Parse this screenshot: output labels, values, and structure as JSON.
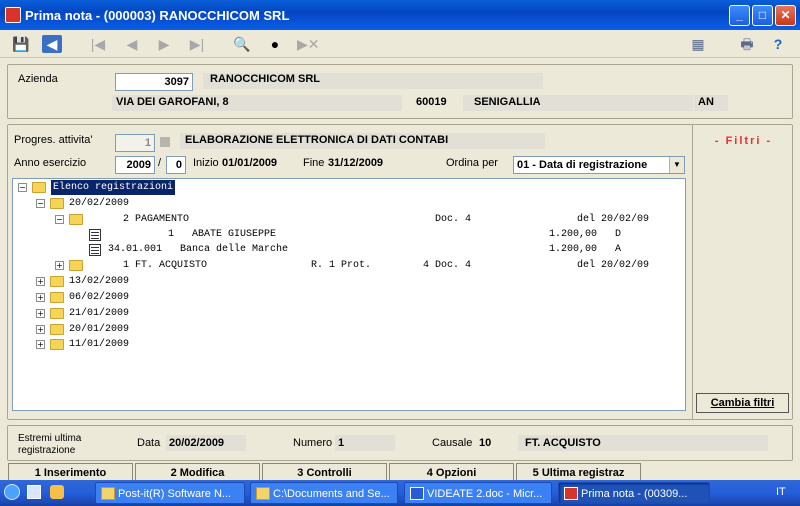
{
  "window": {
    "title": "Prima nota  -  (000003) RANOCCHICOM SRL"
  },
  "azienda": {
    "label": "Azienda",
    "code": "3097",
    "name": "RANOCCHICOM SRL",
    "address": "VIA DEI GAROFANI, 8",
    "cap": "60019",
    "city": "SENIGALLIA",
    "province": "AN"
  },
  "attivita": {
    "label": "Progres. attivita'",
    "value": "1",
    "description": "ELABORAZIONE ELETTRONICA DI DATI CONTABI"
  },
  "esercizio": {
    "label": "Anno esercizio",
    "year": "2009",
    "slash": "/",
    "sub": "0",
    "inizio_label": "Inizio",
    "inizio": "01/01/2009",
    "fine_label": "Fine",
    "fine": "31/12/2009",
    "ordina_label": "Ordina per",
    "ordina_value": "01 - Data di registrazione"
  },
  "filtri": {
    "title": "- Filtri -",
    "button": "Cambia filtri"
  },
  "tree": {
    "root": "Elenco registrazioni",
    "rows": [
      {
        "text": "20/02/2009"
      },
      {
        "text": "2 PAGAMENTO",
        "doc": "Doc. 4",
        "date": "del 20/02/09"
      },
      {
        "text": "1   ABATE GIUSEPPE",
        "amount": "1.200,00",
        "sign": "D"
      },
      {
        "text": "34.01.001   Banca delle Marche",
        "amount": "1.200,00",
        "sign": "A"
      },
      {
        "text": "1 FT. ACQUISTO",
        "prot": "R. 1 Prot.",
        "doc": "4 Doc. 4",
        "date": "del 20/02/09"
      },
      {
        "text": "13/02/2009"
      },
      {
        "text": "06/02/2009"
      },
      {
        "text": "21/01/2009"
      },
      {
        "text": "20/01/2009"
      },
      {
        "text": "11/01/2009"
      }
    ]
  },
  "ultima": {
    "label1": "Estremi ultima",
    "label2": "registrazione",
    "data_label": "Data",
    "data": "20/02/2009",
    "numero_label": "Numero",
    "numero": "1",
    "causale_label": "Causale",
    "causale_code": "10",
    "causale_desc": "FT. ACQUISTO"
  },
  "footer_buttons": [
    "1 Inserimento",
    "2 Modifica",
    "3 Controlli",
    "4 Opzioni",
    "5 Ultima registraz"
  ],
  "taskbar": {
    "items": [
      "Post-it(R) Software N...",
      "C:\\Documents and Se...",
      "VIDEATE 2.doc - Micr...",
      "Prima nota  - (00309..."
    ],
    "lang": "IT"
  }
}
